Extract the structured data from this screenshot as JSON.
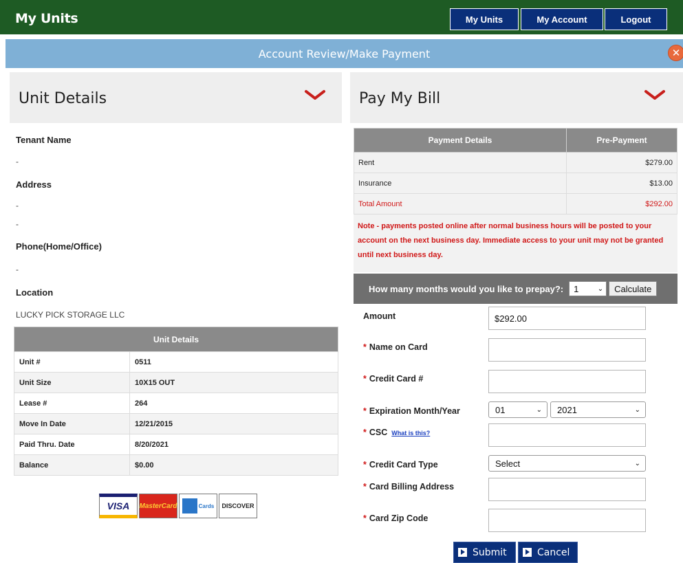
{
  "header": {
    "title": "My Units",
    "nav": [
      "My Units",
      "My Account",
      "Logout"
    ]
  },
  "banner": {
    "title": "Account Review/Make Payment",
    "close_icon": "close-circle-icon"
  },
  "unit_panel": {
    "title": "Unit Details",
    "fields": [
      {
        "label": "Tenant Name",
        "values": [
          "-"
        ]
      },
      {
        "label": "Address",
        "values": [
          "-",
          "-"
        ]
      },
      {
        "label": "Phone(Home/Office)",
        "values": [
          "-"
        ]
      },
      {
        "label": "Location",
        "values": [
          "LUCKY PICK STORAGE LLC"
        ]
      }
    ],
    "table": {
      "header": "Unit Details",
      "rows": [
        [
          "Unit #",
          "0511"
        ],
        [
          "Unit Size",
          "10X15 OUT"
        ],
        [
          "Lease #",
          "264"
        ],
        [
          "Move In Date",
          "12/21/2015"
        ],
        [
          "Paid Thru. Date",
          "8/20/2021"
        ],
        [
          "Balance",
          "$0.00"
        ]
      ]
    },
    "cards": [
      "VISA",
      "MasterCard",
      "Cards",
      "DISCOVER"
    ]
  },
  "pay_panel": {
    "title": "Pay My Bill",
    "table": {
      "headers": [
        "Payment Details",
        "Pre-Payment"
      ],
      "rows": [
        [
          "Rent",
          "$279.00"
        ],
        [
          "Insurance",
          "$13.00"
        ],
        [
          "Total Amount",
          "$292.00"
        ]
      ]
    },
    "note": "Note - payments posted online after normal business hours will be posted to your account on the next business day. Immediate access to your unit may not be granted until next business day.",
    "prepay": {
      "label": "How many months would you like to prepay?:",
      "value": "1",
      "button": "Calculate"
    },
    "form": {
      "amount_label": "Amount",
      "amount_value": "$292.00",
      "name_label": "Name on  Card",
      "cc_label": "Credit Card #",
      "exp_label": "Expiration Month/Year",
      "exp_month": "01",
      "exp_year": "2021",
      "csc_label": "CSC",
      "csc_link": "What is this?",
      "type_label": "Credit Card Type",
      "type_value": "Select",
      "address_label": "Card Billing Address",
      "zip_label": "Card Zip Code",
      "required_mark": "*"
    },
    "buttons": {
      "submit": "Submit",
      "cancel": "Cancel"
    }
  },
  "colors": {
    "header_green": "#1e5b24",
    "nav_blue": "#0a2f7a",
    "banner_blue": "#7fb0d6",
    "alert_red": "#d01818",
    "chevron_red": "#c8201c"
  }
}
